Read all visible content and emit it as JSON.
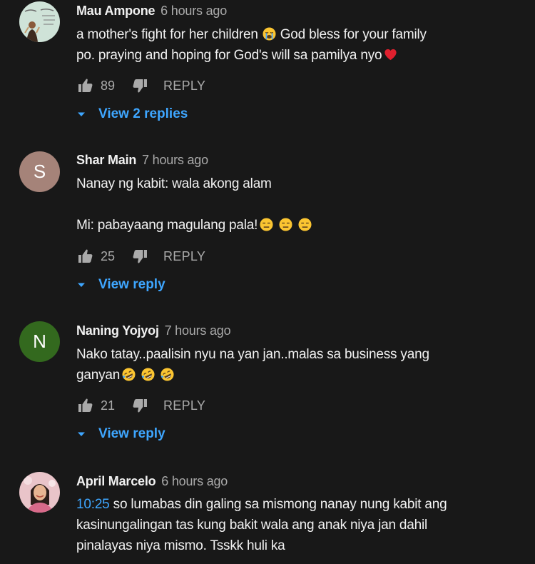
{
  "colors": {
    "background": "#181818",
    "text_primary": "#f1f1f1",
    "text_secondary": "#aaaaaa",
    "link": "#3ea6ff",
    "avatar_s": "#a58379",
    "avatar_n": "#33691e"
  },
  "comments": [
    {
      "author": "Mau Ampone",
      "time": "6 hours ago",
      "avatar_icon": "profile-photo-icon",
      "lines": [
        "a mother's fight for her children",
        "God bless for your family",
        "po. praying and hoping for God's will sa pamilya nyo"
      ],
      "emojis": [
        "loudly-crying-face-icon",
        "red-heart-icon"
      ],
      "likes": "89",
      "reply_label": "REPLY",
      "view_replies_label": "View 2 replies"
    },
    {
      "author": "Shar Main",
      "time": "7 hours ago",
      "avatar_letter": "S",
      "lines": [
        "Nanay ng kabit: wala akong alam",
        "Mi: pabayaang magulang pala!"
      ],
      "emojis": [
        "expressionless-face-icon",
        "expressionless-face-icon",
        "expressionless-face-icon"
      ],
      "likes": "25",
      "reply_label": "REPLY",
      "view_replies_label": "View reply"
    },
    {
      "author": "Naning Yojyoj",
      "time": "7 hours ago",
      "avatar_letter": "N",
      "lines": [
        "Nako tatay..paalisin nyu na yan jan..malas sa business yang",
        "ganyan"
      ],
      "emojis": [
        "rofl-face-icon",
        "rofl-face-icon",
        "rofl-face-icon"
      ],
      "likes": "21",
      "reply_label": "REPLY",
      "view_replies_label": "View reply"
    },
    {
      "author": "April Marcelo",
      "time": "6 hours ago",
      "avatar_icon": "profile-photo-icon",
      "timestamp_link": "10:25",
      "lines": [
        "so lumabas din galing sa mismong nanay nung kabit ang",
        "kasinungalingan tas kung bakit wala ang anak niya jan dahil",
        "pinalayas niya mismo. Tsskk huli ka"
      ]
    }
  ]
}
